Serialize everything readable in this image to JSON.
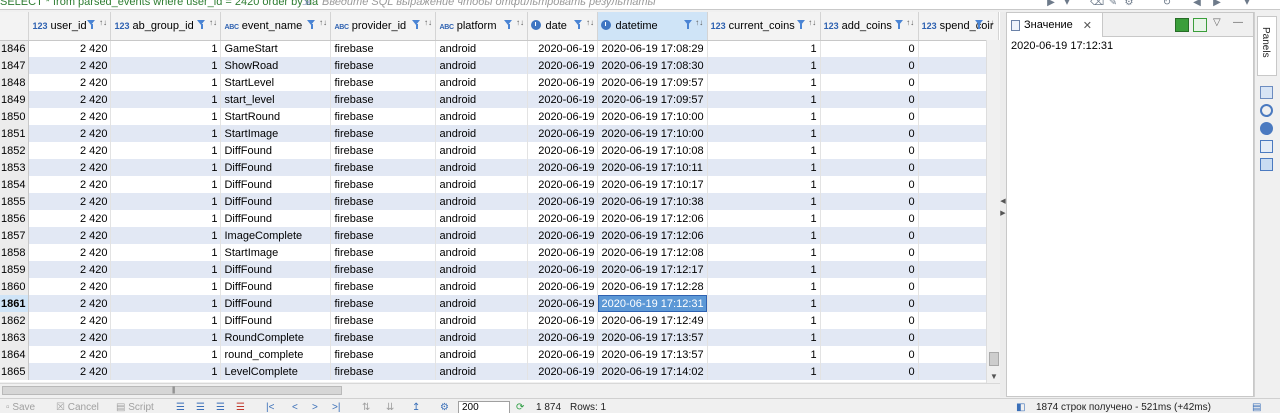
{
  "filter": {
    "sql": "SELECT * from parsed_events where user_id = 2420 order by  da",
    "placeholder": "Введите SQL выражение чтобы отфильтровать результаты"
  },
  "grid": {
    "columns": [
      {
        "type": "123",
        "name": "user_id"
      },
      {
        "type": "123",
        "name": "ab_group_id"
      },
      {
        "type": "ABC",
        "name": "event_name"
      },
      {
        "type": "ABC",
        "name": "provider_id"
      },
      {
        "type": "ABC",
        "name": "platform"
      },
      {
        "type": "clock",
        "name": "date"
      },
      {
        "type": "clock",
        "name": "datetime"
      },
      {
        "type": "123",
        "name": "current_coins"
      },
      {
        "type": "123",
        "name": "add_coins"
      },
      {
        "type": "123",
        "name": "spend_coir"
      }
    ],
    "rows": [
      [
        "1846",
        "2 420",
        "1",
        "GameStart",
        "firebase",
        "android",
        "2020-06-19",
        "2020-06-19 17:08:29",
        "1",
        "0"
      ],
      [
        "1847",
        "2 420",
        "1",
        "ShowRoad",
        "firebase",
        "android",
        "2020-06-19",
        "2020-06-19 17:08:30",
        "1",
        "0"
      ],
      [
        "1848",
        "2 420",
        "1",
        "StartLevel",
        "firebase",
        "android",
        "2020-06-19",
        "2020-06-19 17:09:57",
        "1",
        "0"
      ],
      [
        "1849",
        "2 420",
        "1",
        "start_level",
        "firebase",
        "android",
        "2020-06-19",
        "2020-06-19 17:09:57",
        "1",
        "0"
      ],
      [
        "1850",
        "2 420",
        "1",
        "StartRound",
        "firebase",
        "android",
        "2020-06-19",
        "2020-06-19 17:10:00",
        "1",
        "0"
      ],
      [
        "1851",
        "2 420",
        "1",
        "StartImage",
        "firebase",
        "android",
        "2020-06-19",
        "2020-06-19 17:10:00",
        "1",
        "0"
      ],
      [
        "1852",
        "2 420",
        "1",
        "DiffFound",
        "firebase",
        "android",
        "2020-06-19",
        "2020-06-19 17:10:08",
        "1",
        "0"
      ],
      [
        "1853",
        "2 420",
        "1",
        "DiffFound",
        "firebase",
        "android",
        "2020-06-19",
        "2020-06-19 17:10:11",
        "1",
        "0"
      ],
      [
        "1854",
        "2 420",
        "1",
        "DiffFound",
        "firebase",
        "android",
        "2020-06-19",
        "2020-06-19 17:10:17",
        "1",
        "0"
      ],
      [
        "1855",
        "2 420",
        "1",
        "DiffFound",
        "firebase",
        "android",
        "2020-06-19",
        "2020-06-19 17:10:38",
        "1",
        "0"
      ],
      [
        "1856",
        "2 420",
        "1",
        "DiffFound",
        "firebase",
        "android",
        "2020-06-19",
        "2020-06-19 17:12:06",
        "1",
        "0"
      ],
      [
        "1857",
        "2 420",
        "1",
        "ImageComplete",
        "firebase",
        "android",
        "2020-06-19",
        "2020-06-19 17:12:06",
        "1",
        "0"
      ],
      [
        "1858",
        "2 420",
        "1",
        "StartImage",
        "firebase",
        "android",
        "2020-06-19",
        "2020-06-19 17:12:08",
        "1",
        "0"
      ],
      [
        "1859",
        "2 420",
        "1",
        "DiffFound",
        "firebase",
        "android",
        "2020-06-19",
        "2020-06-19 17:12:17",
        "1",
        "0"
      ],
      [
        "1860",
        "2 420",
        "1",
        "DiffFound",
        "firebase",
        "android",
        "2020-06-19",
        "2020-06-19 17:12:28",
        "1",
        "0"
      ],
      [
        "1861",
        "2 420",
        "1",
        "DiffFound",
        "firebase",
        "android",
        "2020-06-19",
        "2020-06-19 17:12:31",
        "1",
        "0"
      ],
      [
        "1862",
        "2 420",
        "1",
        "DiffFound",
        "firebase",
        "android",
        "2020-06-19",
        "2020-06-19 17:12:49",
        "1",
        "0"
      ],
      [
        "1863",
        "2 420",
        "1",
        "RoundComplete",
        "firebase",
        "android",
        "2020-06-19",
        "2020-06-19 17:13:57",
        "1",
        "0"
      ],
      [
        "1864",
        "2 420",
        "1",
        "round_complete",
        "firebase",
        "android",
        "2020-06-19",
        "2020-06-19 17:13:57",
        "1",
        "0"
      ],
      [
        "1865",
        "2 420",
        "1",
        "LevelComplete",
        "firebase",
        "android",
        "2020-06-19",
        "2020-06-19 17:14:02",
        "1",
        "0"
      ]
    ],
    "selected_row": "1861",
    "selected_column": "datetime"
  },
  "value_panel": {
    "tab_label": "Значение",
    "value": "2020-06-19 17:12:31"
  },
  "side": {
    "panels_label": "Panels"
  },
  "bottom": {
    "save": "Save",
    "cancel": "Cancel",
    "script": "Script",
    "fetch_size": "200",
    "row_count": "1 874",
    "rows": "Rows: 1",
    "status": "1874 строк получено - 521ms (+42ms)"
  },
  "colors": {
    "selection": "#5c98d6",
    "alt_row": "#e2e8f4",
    "type_icon": "#2f62b1",
    "sql_text": "#2e7d32"
  }
}
